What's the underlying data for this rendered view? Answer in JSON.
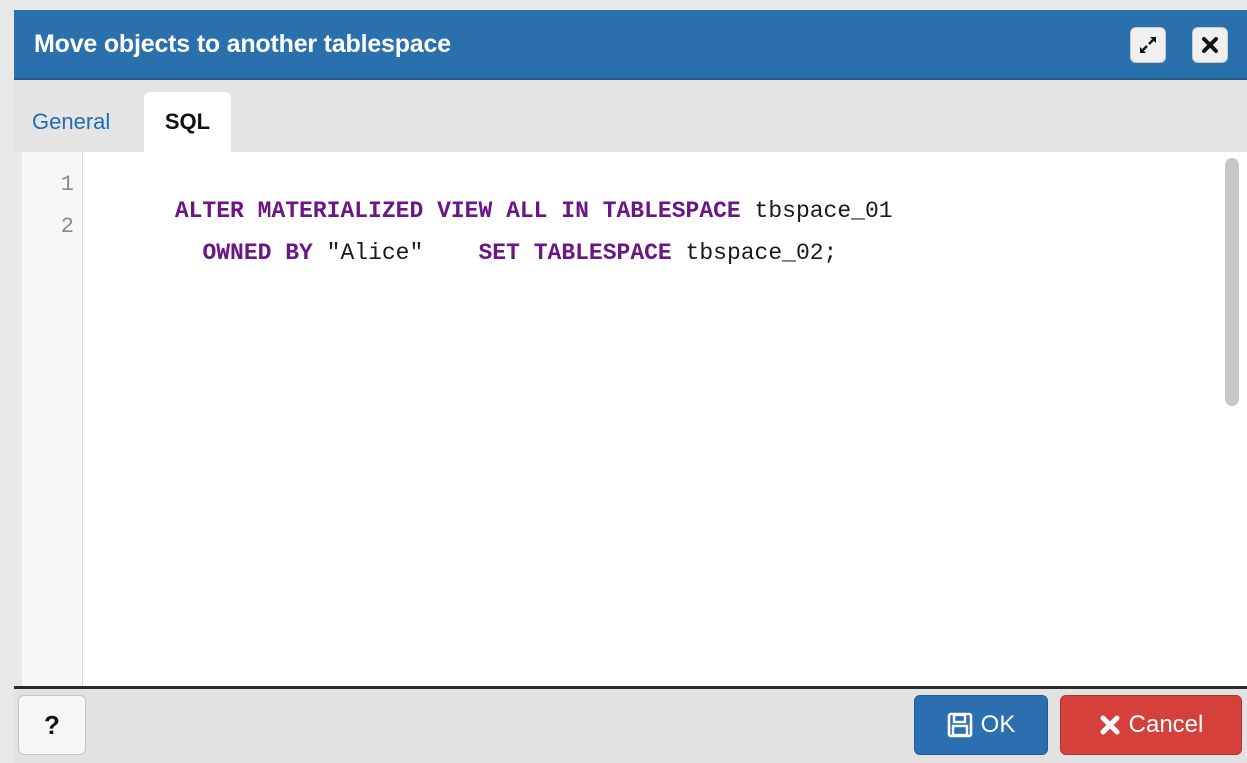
{
  "dialog": {
    "title": "Move objects to another tablespace",
    "icons": {
      "maximize": "expand-arrows-icon",
      "close": "close-x-icon"
    }
  },
  "tabs": [
    {
      "label": "General",
      "active": false
    },
    {
      "label": "SQL",
      "active": true
    }
  ],
  "editor": {
    "line_numbers": [
      "1",
      "2"
    ],
    "lines": [
      [
        {
          "text": "ALTER MATERIALIZED VIEW ALL IN TABLESPACE",
          "kind": "keyword"
        },
        {
          "text": " tbspace_01",
          "kind": "plain"
        }
      ],
      [
        {
          "text": "  ",
          "kind": "plain"
        },
        {
          "text": "OWNED BY",
          "kind": "keyword"
        },
        {
          "text": " \"Alice\"    ",
          "kind": "plain"
        },
        {
          "text": "SET TABLESPACE",
          "kind": "keyword"
        },
        {
          "text": " tbspace_02;",
          "kind": "plain"
        }
      ]
    ]
  },
  "footer": {
    "help_label": "?",
    "ok_label": "OK",
    "cancel_label": "Cancel"
  },
  "colors": {
    "titlebar": "#2a70ad",
    "keyword": "#6b1684",
    "ok_button": "#2b6fb0",
    "cancel_button": "#d6403b",
    "link": "#226eb4"
  }
}
